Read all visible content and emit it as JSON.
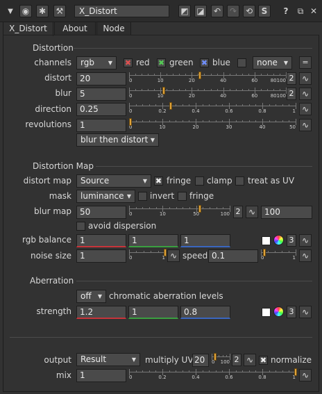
{
  "titlebar": {
    "node_name": "X_Distort",
    "help_label": "?",
    "s_label": "S"
  },
  "tabs": [
    "X_Distort",
    "About",
    "Node"
  ],
  "distortion": {
    "section": "Distortion",
    "channels_label": "channels",
    "channels_value": "rgb",
    "red_label": "red",
    "green_label": "green",
    "blue_label": "blue",
    "none_value": "none",
    "eq_label": "=",
    "distort_label": "distort",
    "distort_value": "20",
    "distort_ticks": [
      "0",
      "10",
      "20",
      "40",
      "60",
      "80100"
    ],
    "blur_label": "blur",
    "blur_value": "5",
    "blur_ticks": [
      "0",
      "10",
      "20",
      "40",
      "60",
      "80100"
    ],
    "direction_label": "direction",
    "direction_value": "0.25",
    "direction_ticks": [
      "0",
      "0.2",
      "0.4",
      "0.6",
      "0.8",
      "1"
    ],
    "revolutions_label": "revolutions",
    "revolutions_value": "1",
    "revolutions_ticks": [
      "0",
      "10",
      "20",
      "30",
      "40",
      "50"
    ],
    "order_value": "blur then distort",
    "count2": "2"
  },
  "distortion_map": {
    "section": "Distortion Map",
    "map_label": "distort map",
    "map_value": "Source",
    "fringe_label": "fringe",
    "clamp_label": "clamp",
    "uv_label": "treat as UV",
    "mask_label": "mask",
    "mask_value": "luminance",
    "invert_label": "invert",
    "fringe2_label": "fringe",
    "blurmap_label": "blur map",
    "blurmap_value": "50",
    "blurmap_ticks": [
      "0",
      "10",
      "50",
      "100"
    ],
    "blurmap_count": "2",
    "blurmap_value2": "100",
    "avoid_label": "avoid dispersion",
    "rgb_label": "rgb balance",
    "rgb_values": [
      "1",
      "1",
      "1"
    ],
    "rgb_count": "3",
    "noise_label": "noise size",
    "noise_value": "1",
    "noise_ticks": [
      "0",
      "1"
    ],
    "speed_label": "speed",
    "speed_value": "0.1",
    "speed_ticks": [
      "0",
      "1"
    ]
  },
  "aberration": {
    "section": "Aberration",
    "mode_value": "off",
    "levels_label": "chromatic aberration levels",
    "strength_label": "strength",
    "strength_values": [
      "1.2",
      "1",
      "0.8"
    ],
    "strength_count": "3"
  },
  "output": {
    "output_label": "output",
    "output_value": "Result",
    "muv_label": "multiply UV",
    "muv_value": "20",
    "muv_ticks": [
      "0",
      "100"
    ],
    "muv_count": "2",
    "normalize_label": "normalize",
    "mix_label": "mix",
    "mix_value": "1",
    "mix_ticks": [
      "0",
      "0.2",
      "0.4",
      "0.6",
      "0.8",
      "1"
    ]
  },
  "accents": {
    "red": "#c8343a",
    "green": "#3aa040",
    "blue": "#3a66c0",
    "handle": "#e0a33a"
  }
}
